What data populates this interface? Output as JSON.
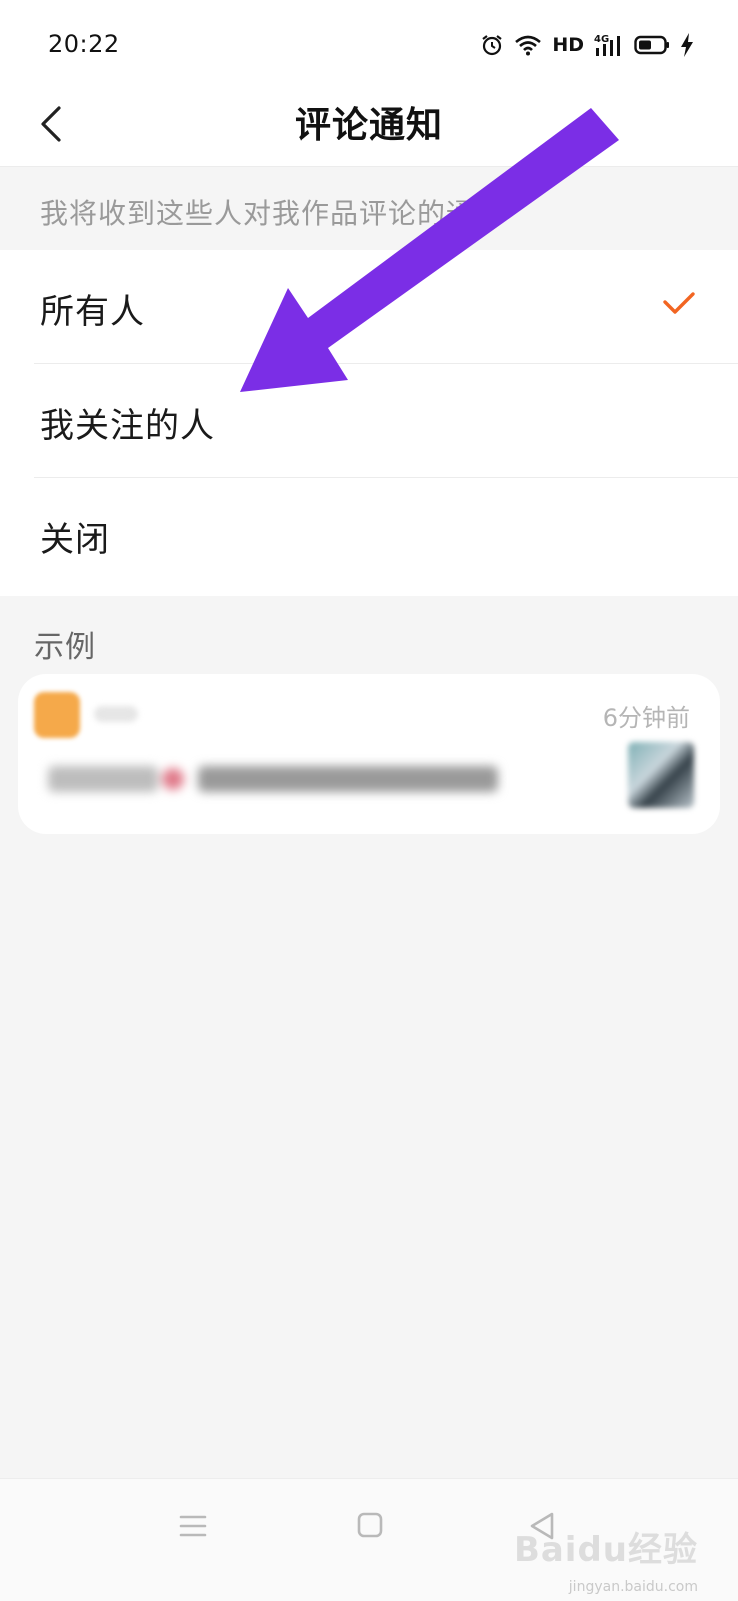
{
  "status_bar": {
    "time": "20:22",
    "hd_label": "HD",
    "icons": [
      "alarm-icon",
      "wifi-icon",
      "signal-4g-icon",
      "battery-icon",
      "charging-icon"
    ]
  },
  "header": {
    "title": "评论通知",
    "back_icon": "chevron-left-icon"
  },
  "description": "我将收到这些人对我作品评论的通知",
  "options": [
    {
      "label": "所有人",
      "selected": true
    },
    {
      "label": "我关注的人",
      "selected": false
    },
    {
      "label": "关闭",
      "selected": false
    }
  ],
  "example": {
    "section_label": "示例",
    "card": {
      "time": "6分钟前"
    }
  },
  "nav_bar": {
    "icons": [
      "menu-icon",
      "home-square-icon",
      "back-triangle-icon"
    ]
  },
  "watermark": {
    "text": "Baidu经验",
    "sub": "jingyan.baidu.com"
  },
  "colors": {
    "accent_check": "#f26522",
    "arrow": "#7b2ee6",
    "background": "#f5f5f5"
  }
}
